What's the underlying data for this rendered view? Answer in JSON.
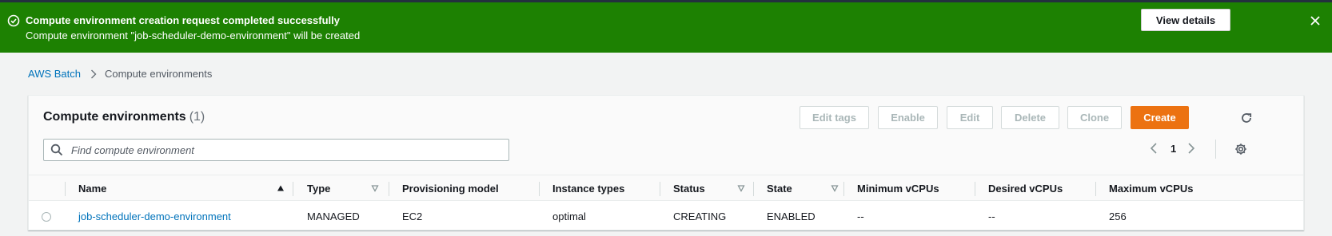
{
  "flash": {
    "title": "Compute environment creation request completed successfully",
    "message": "Compute environment \"job-scheduler-demo-environment\" will be created",
    "view_details": "View details",
    "color": "#1d8102"
  },
  "breadcrumb": {
    "root": "AWS Batch",
    "current": "Compute environments"
  },
  "panel": {
    "title": "Compute environments",
    "count": "(1)",
    "buttons": {
      "edit_tags": "Edit tags",
      "enable": "Enable",
      "edit": "Edit",
      "delete": "Delete",
      "clone": "Clone",
      "create": "Create"
    },
    "search_placeholder": "Find compute environment",
    "page": "1",
    "accent": "#ec7211"
  },
  "table": {
    "columns": {
      "name": "Name",
      "type": "Type",
      "provisioning": "Provisioning model",
      "instance_types": "Instance types",
      "status": "Status",
      "state": "State",
      "min_vcpus": "Minimum vCPUs",
      "desired_vcpus": "Desired vCPUs",
      "max_vcpus": "Maximum vCPUs"
    },
    "rows": [
      {
        "name": "job-scheduler-demo-environment",
        "type": "MANAGED",
        "provisioning": "EC2",
        "instance_types": "optimal",
        "status": "CREATING",
        "state": "ENABLED",
        "min_vcpus": "--",
        "desired_vcpus": "--",
        "max_vcpus": "256"
      }
    ]
  }
}
